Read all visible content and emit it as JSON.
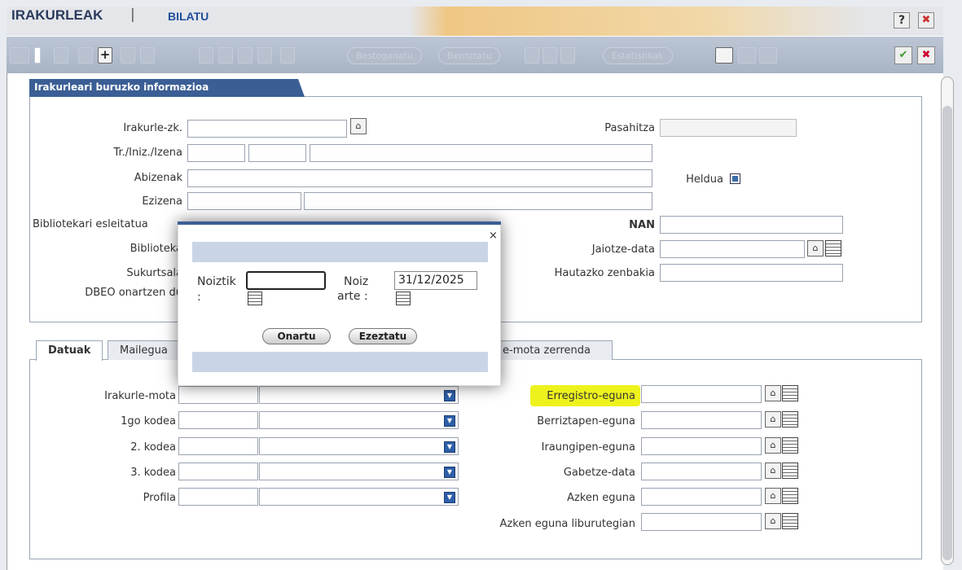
{
  "header": {
    "title": "IRAKURLEAK",
    "separator": "|",
    "mode": "BILATU",
    "help": "?",
    "close": "✖"
  },
  "toolbar": {
    "add": "+",
    "browse_label": "Bestoganatu",
    "renew_label": "Berriztatu",
    "stats_label": "Estatistikak",
    "accept": "✔",
    "cancel": "✖"
  },
  "info": {
    "header": "Irakurleari buruzko informazioa",
    "reader_no_label": "Irakurle-zk.",
    "title_initial_name_label": "Tr./Iniz./Izena",
    "surnames_label": "Abizenak",
    "nickname_label": "Ezizena",
    "librarian_assigned_label": "Bibliotekari esleitatua",
    "library_label": "Biblioteka",
    "branch_label": "Sukurtsala",
    "dbeo_label": "DBEO onartzen du",
    "password_label": "Pasahitza",
    "adult_label": "Heldua",
    "nan_label": "NAN",
    "birth_date_label": "Jaiotze-data",
    "optional_number_label": "Hautazko zenbakia"
  },
  "tabs": [
    {
      "label": "Datuak"
    },
    {
      "label": "Mailegua"
    },
    {
      "label": "e-mota zerrenda"
    }
  ],
  "data_tab": {
    "reader_type_label": "Irakurle-mota",
    "code1_label": "1go kodea",
    "code2_label": "2. kodea",
    "code3_label": "3. kodea",
    "profile_label": "Profila",
    "registration_day_label": "Erregistro-eguna",
    "renewal_day_label": "Berriztapen-eguna",
    "expiry_day_label": "Iraungipen-eguna",
    "deprivation_date_label": "Gabetze-data",
    "last_day_label": "Azken eguna",
    "last_day_books_label": "Azken eguna liburutegian"
  },
  "dialog": {
    "close": "×",
    "from_label": "Noiztik",
    "from_colon": ":",
    "from_value": "",
    "to_label": "Noiz",
    "to_label2": "arte :",
    "to_value": "31/12/2025",
    "ok_label": "Onartu",
    "cancel_label": "Ezeztatu"
  },
  "colors": {
    "accent": "#3b5e95",
    "highlight": "#eef21c"
  }
}
